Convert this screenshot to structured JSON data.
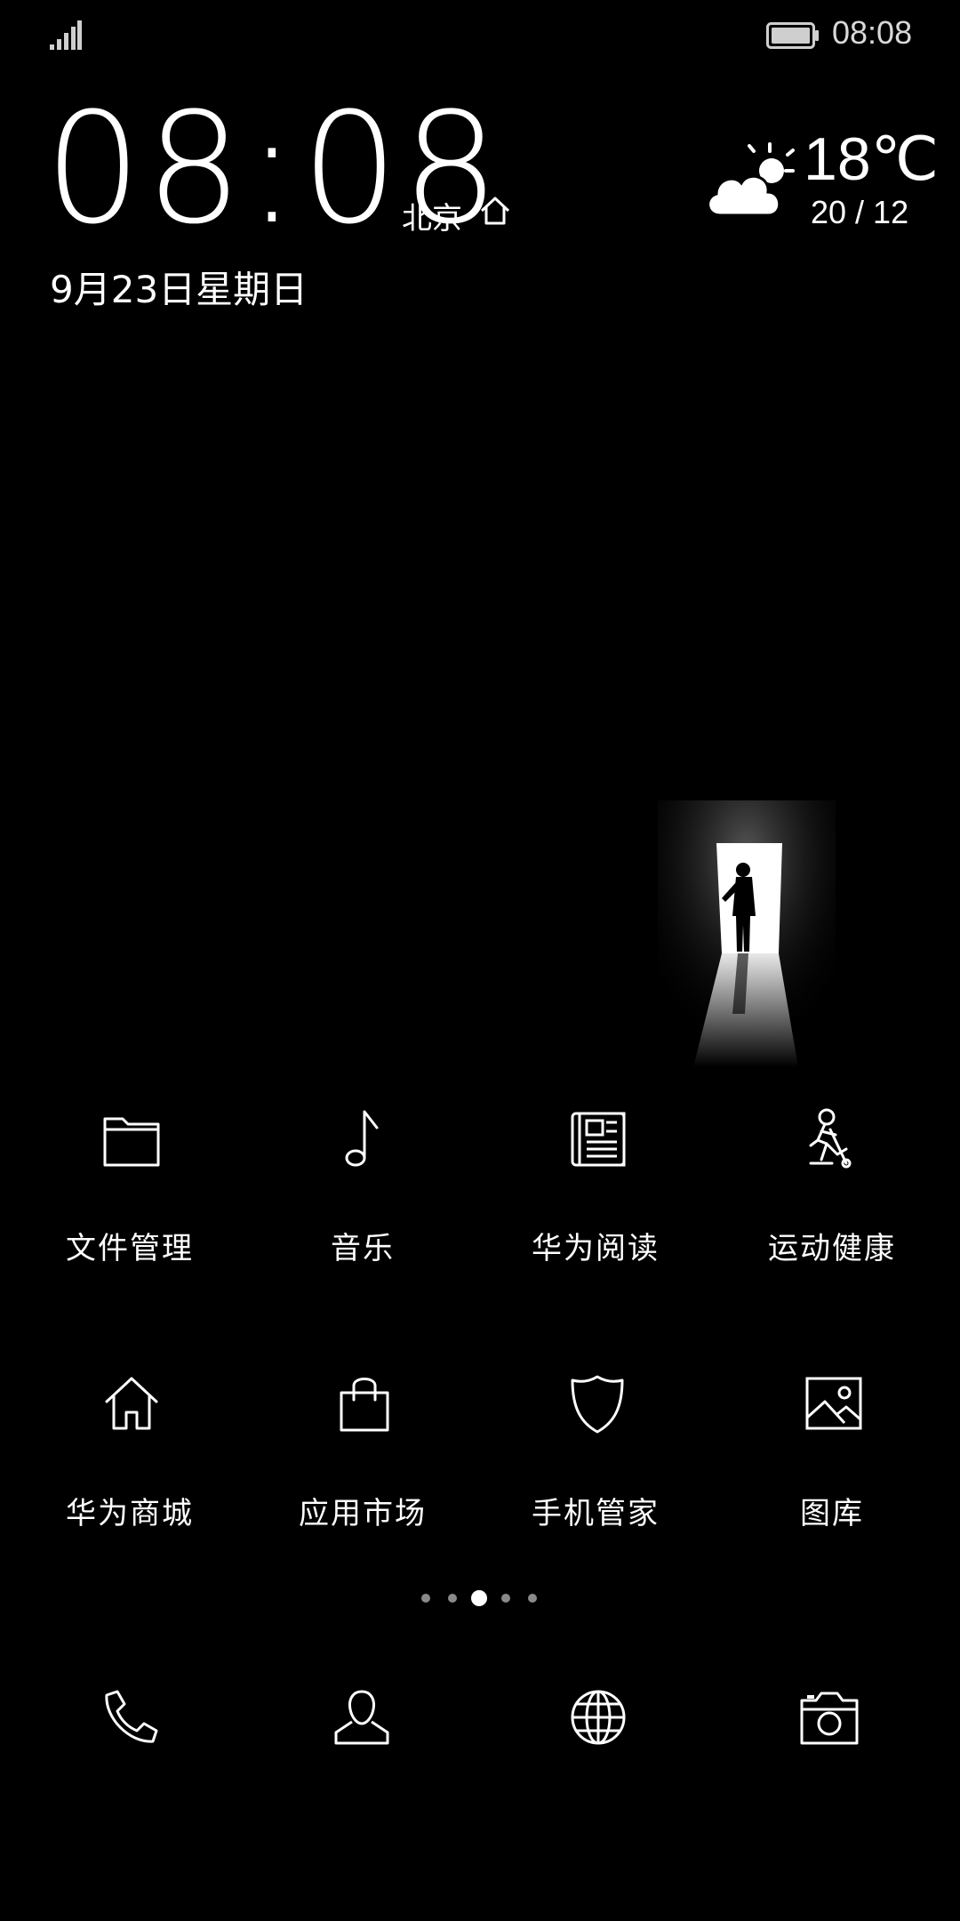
{
  "status_bar": {
    "time": "08:08",
    "signal_icon": "signal-icon",
    "battery_icon": "battery-icon"
  },
  "clock_widget": {
    "time": "08:08",
    "city": "北京",
    "date": "9月23日星期日"
  },
  "weather": {
    "icon": "partly-cloudy-icon",
    "temperature": "18℃",
    "range": "20 / 12"
  },
  "apps": [
    {
      "label": "文件管理",
      "icon": "folder-icon"
    },
    {
      "label": "音乐",
      "icon": "music-note-icon"
    },
    {
      "label": "华为阅读",
      "icon": "news-icon"
    },
    {
      "label": "运动健康",
      "icon": "fitness-icon"
    },
    {
      "label": "华为商城",
      "icon": "home-icon"
    },
    {
      "label": "应用市场",
      "icon": "shopping-bag-icon"
    },
    {
      "label": "手机管家",
      "icon": "shield-icon"
    },
    {
      "label": "图库",
      "icon": "gallery-icon"
    }
  ],
  "page_indicator": {
    "total": 5,
    "active": 3
  },
  "dock": [
    {
      "icon": "phone-icon"
    },
    {
      "icon": "contacts-icon"
    },
    {
      "icon": "browser-globe-icon"
    },
    {
      "icon": "camera-icon"
    }
  ],
  "colors": {
    "background": "#000000",
    "foreground": "#ffffff",
    "dot_inactive": "#8a8a8a"
  }
}
